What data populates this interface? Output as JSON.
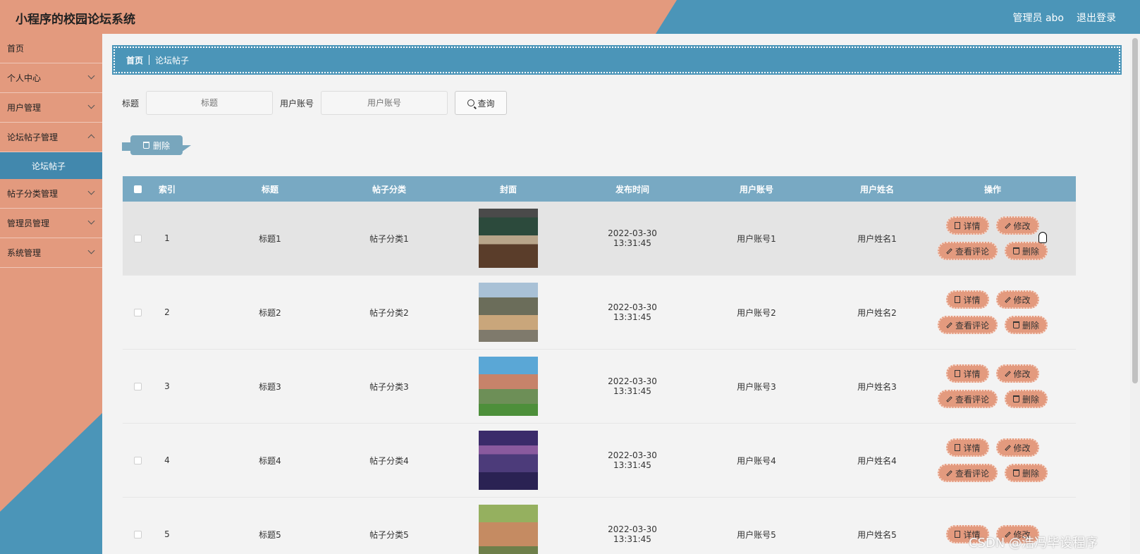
{
  "header": {
    "app_title": "小程序的校园论坛系统",
    "user_label": "管理员 abo",
    "logout": "退出登录"
  },
  "sidebar": {
    "items": [
      {
        "label": "首页",
        "has_children": false
      },
      {
        "label": "个人中心",
        "has_children": true
      },
      {
        "label": "用户管理",
        "has_children": true
      },
      {
        "label": "论坛帖子管理",
        "has_children": true
      },
      {
        "label": "论坛帖子",
        "active_sub": true
      },
      {
        "label": "帖子分类管理",
        "has_children": true
      },
      {
        "label": "管理员管理",
        "has_children": true
      },
      {
        "label": "系统管理",
        "has_children": true
      }
    ]
  },
  "breadcrumb": {
    "home": "首页",
    "current": "论坛帖子"
  },
  "search": {
    "title_label": "标题",
    "title_placeholder": "标题",
    "account_label": "用户账号",
    "account_placeholder": "用户账号",
    "query_button": "查询"
  },
  "toolbar": {
    "delete_label": "删除"
  },
  "table": {
    "headers": [
      "索引",
      "标题",
      "帖子分类",
      "封面",
      "发布时间",
      "用户账号",
      "用户姓名",
      "操作"
    ],
    "rows": [
      {
        "index": "1",
        "title": "标题1",
        "category": "帖子分类1",
        "time": "2022-03-30 13:31:45",
        "account": "用户账号1",
        "name": "用户姓名1"
      },
      {
        "index": "2",
        "title": "标题2",
        "category": "帖子分类2",
        "time": "2022-03-30 13:31:45",
        "account": "用户账号2",
        "name": "用户姓名2"
      },
      {
        "index": "3",
        "title": "标题3",
        "category": "帖子分类3",
        "time": "2022-03-30 13:31:45",
        "account": "用户账号3",
        "name": "用户姓名3"
      },
      {
        "index": "4",
        "title": "标题4",
        "category": "帖子分类4",
        "time": "2022-03-30 13:31:45",
        "account": "用户账号4",
        "name": "用户姓名4"
      },
      {
        "index": "5",
        "title": "标题5",
        "category": "帖子分类5",
        "time": "2022-03-30 13:31:45",
        "account": "用户账号5",
        "name": "用户姓名5"
      }
    ],
    "row_actions": {
      "detail": "详情",
      "edit": "修改",
      "comments": "查看评论",
      "delete": "删除"
    }
  },
  "watermark": "CSDN @浩冯毕设程序",
  "colors": {
    "salmon": "#e39a7e",
    "blue": "#4b95b8",
    "header_row": "#78a9c3"
  }
}
